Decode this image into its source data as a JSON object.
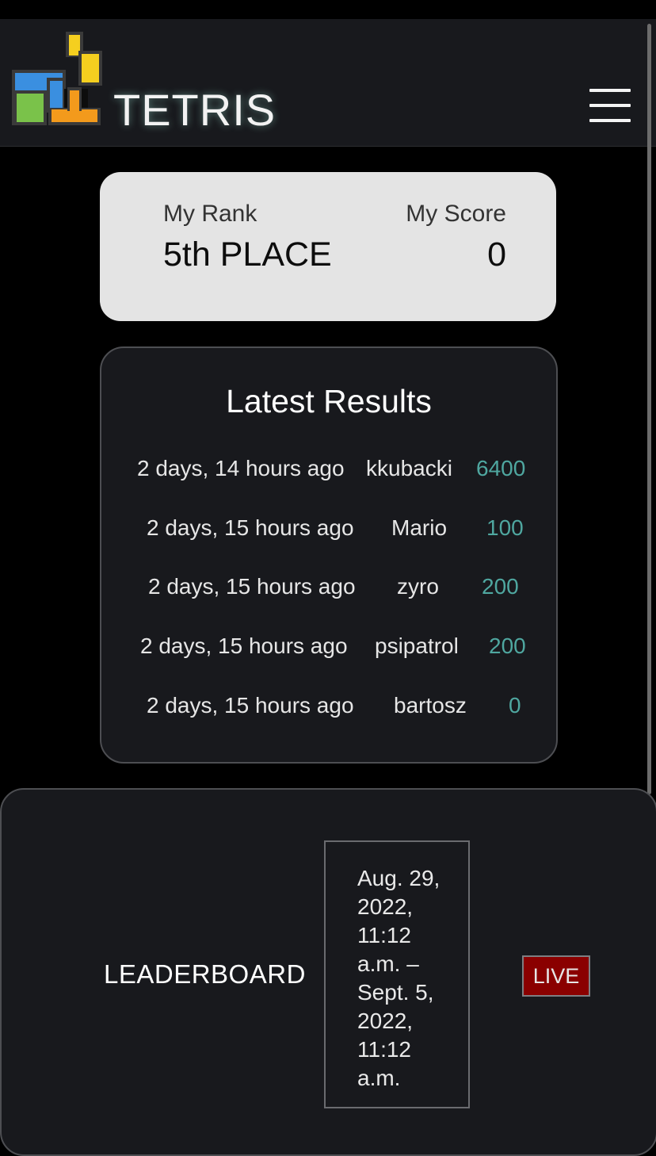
{
  "header": {
    "brand": "TETRIS",
    "logo_icon": "tetris-blocks-logo",
    "menu_icon": "hamburger-menu-icon",
    "colors": {
      "blue": "#3a8fe0",
      "yellow": "#f5cf1f",
      "green": "#7ac24a",
      "orange": "#f39a1c",
      "dark": "#0d0d0d",
      "frame": "#3a3a3a"
    }
  },
  "rank_card": {
    "rank_label": "My Rank",
    "rank_value": "5th PLACE",
    "score_label": "My Score",
    "score_value": "0"
  },
  "latest_results": {
    "title": "Latest Results",
    "score_color": "#4fa7a0",
    "rows": [
      {
        "time": "2 days, 14 hours ago",
        "player": "kkubacki",
        "score": "6400"
      },
      {
        "time": "2 days, 15 hours ago",
        "player": "Mario",
        "score": "100"
      },
      {
        "time": "2 days, 15 hours ago",
        "player": "zyro",
        "score": "200"
      },
      {
        "time": "2 days, 15 hours ago",
        "player": "psipatrol",
        "score": "200"
      },
      {
        "time": "2 days, 15 hours ago",
        "player": "bartosz",
        "score": "0"
      }
    ]
  },
  "leaderboard": {
    "title": "LEADERBOARD",
    "date_range": "Aug. 29, 2022, 11:12 a.m. – Sept. 5, 2022, 11:12 a.m.",
    "status": "LIVE",
    "status_color": "#8a0000"
  }
}
